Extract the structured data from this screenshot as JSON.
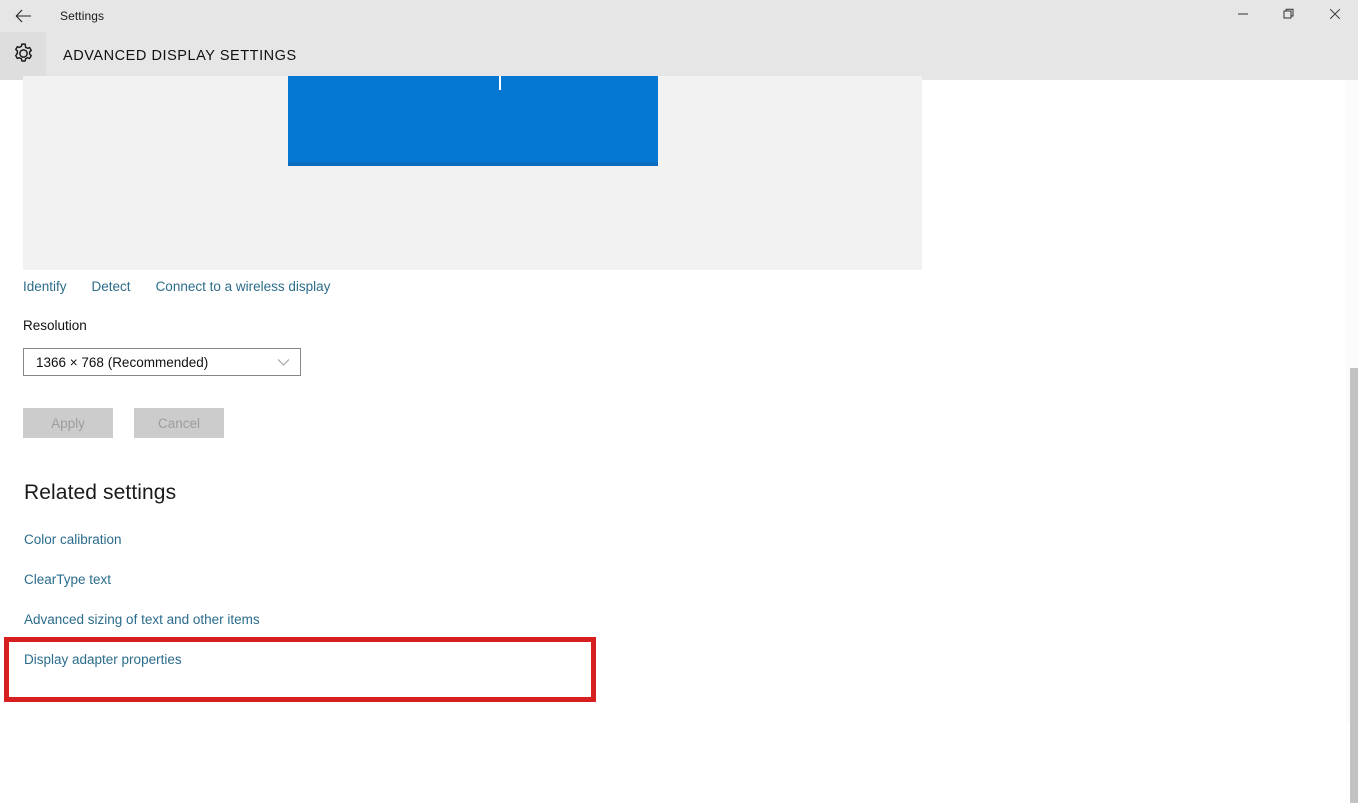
{
  "window": {
    "app_title": "Settings",
    "back_icon": "back-arrow-icon",
    "minimize_icon": "minimize-icon",
    "restore_icon": "restore-icon",
    "close_icon": "close-icon"
  },
  "header": {
    "gear_icon": "gear-icon",
    "page_title": "ADVANCED DISPLAY SETTINGS"
  },
  "preview": {
    "monitor_color": "#0678d4",
    "panel_color": "#f2f2f2"
  },
  "display_actions": [
    {
      "label": "Identify"
    },
    {
      "label": "Detect"
    },
    {
      "label": "Connect to a wireless display"
    }
  ],
  "resolution": {
    "label": "Resolution",
    "value": "1366 × 768 (Recommended)",
    "chevron_icon": "chevron-down-icon"
  },
  "buttons": {
    "apply_label": "Apply",
    "cancel_label": "Cancel",
    "disabled": true
  },
  "related": {
    "heading": "Related settings",
    "links": [
      {
        "label": "Color calibration"
      },
      {
        "label": "ClearType text"
      },
      {
        "label": "Advanced sizing of text and other items"
      },
      {
        "label": "Display adapter properties"
      }
    ]
  },
  "annotation": {
    "color": "#d81f1f",
    "target": "Display adapter properties"
  },
  "colors": {
    "link": "#2b6c8c",
    "chrome": "#e6e6e6",
    "accent": "#0678d4"
  }
}
